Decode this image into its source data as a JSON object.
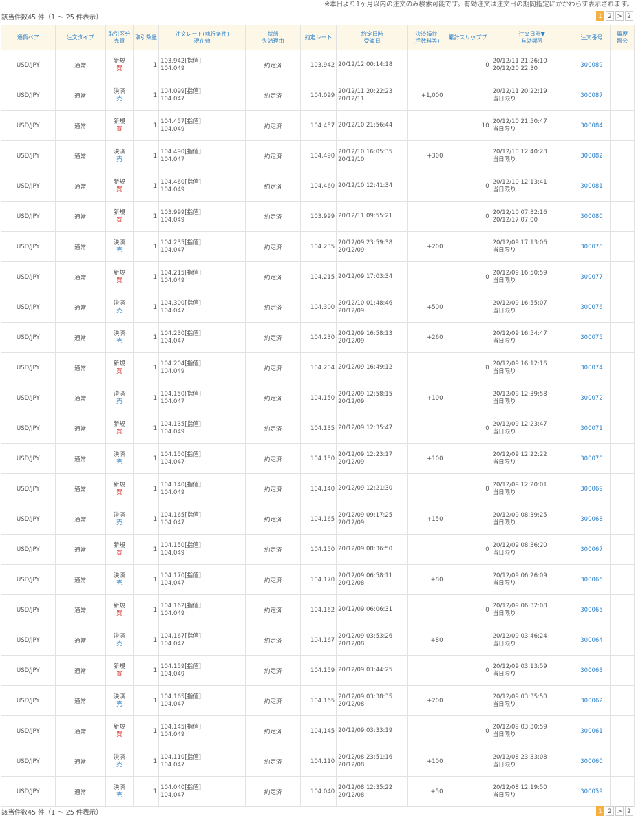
{
  "notice": "※本日より1ヶ月以内の注文のみ検索可能です。有効注文は注文日の期間指定にかかわらず表示されます。",
  "count_label": "該当件数45 件（1 ～ 25 件表示）",
  "count_label_bottom": "該当件数45 件（1 ～ 25 件表示）",
  "pager": [
    "1",
    "2",
    ">",
    "2"
  ],
  "colors": {
    "accent": "#f6b042",
    "header_bg": "#fdf7e8",
    "link": "#2f82c8",
    "sell": "#d9362f"
  },
  "headers": {
    "pair": "通貨ペア",
    "type": "注文タイプ",
    "trade_a": "取引区分",
    "trade_b": "売買",
    "qty": "取引数量",
    "rate_a": "注文レート(執行条件)",
    "rate_b": "現在値",
    "status_a": "状態",
    "status_b": "失効理由",
    "exec": "約定レート",
    "date_a": "約定日時",
    "date_b": "受渡日",
    "pl_a": "決済損益",
    "pl_b": "(手数料等)",
    "slip": "累計スリッププ",
    "order_a": "注文日時▼",
    "order_b": "有効期限",
    "no": "注文番号",
    "hist_a": "履歴",
    "hist_b": "照会"
  },
  "rows": [
    {
      "pair": "USD/JPY",
      "type": "通常",
      "kind": "新規",
      "side": "買",
      "rate": "103.942[指値]",
      "current": "104.049",
      "status": "約定済",
      "exec": "103.942",
      "date1": "20/12/12 00:14:18",
      "date2": "",
      "pl": "",
      "slip": "0",
      "od1": "20/12/11 21:26:10",
      "od2": "20/12/20 22:30",
      "no": "300089"
    },
    {
      "pair": "USD/JPY",
      "type": "通常",
      "kind": "決済",
      "side": "売",
      "rate": "104.099[指値]",
      "current": "104.047",
      "status": "約定済",
      "exec": "104.099",
      "date1": "20/12/11 20:22:23",
      "date2": "20/12/11",
      "pl": "+1,000",
      "slip": "",
      "od1": "20/12/11 20:22:19",
      "od2": "当日限り",
      "no": "300087"
    },
    {
      "pair": "USD/JPY",
      "type": "通常",
      "kind": "新規",
      "side": "買",
      "rate": "104.457[指値]",
      "current": "104.049",
      "status": "約定済",
      "exec": "104.457",
      "date1": "20/12/10 21:56:44",
      "date2": "",
      "pl": "",
      "slip": "10",
      "od1": "20/12/10 21:50:47",
      "od2": "当日限り",
      "no": "300084"
    },
    {
      "pair": "USD/JPY",
      "type": "通常",
      "kind": "決済",
      "side": "売",
      "rate": "104.490[指値]",
      "current": "104.047",
      "status": "約定済",
      "exec": "104.490",
      "date1": "20/12/10 16:05:35",
      "date2": "20/12/10",
      "pl": "+300",
      "slip": "",
      "od1": "20/12/10 12:40:28",
      "od2": "当日限り",
      "no": "300082"
    },
    {
      "pair": "USD/JPY",
      "type": "通常",
      "kind": "新規",
      "side": "買",
      "rate": "104.460[指値]",
      "current": "104.049",
      "status": "約定済",
      "exec": "104.460",
      "date1": "20/12/10 12:41:34",
      "date2": "",
      "pl": "",
      "slip": "0",
      "od1": "20/12/10 12:13:41",
      "od2": "当日限り",
      "no": "300081"
    },
    {
      "pair": "USD/JPY",
      "type": "通常",
      "kind": "新規",
      "side": "買",
      "rate": "103.999[指値]",
      "current": "104.049",
      "status": "約定済",
      "exec": "103.999",
      "date1": "20/12/11 09:55:21",
      "date2": "",
      "pl": "",
      "slip": "0",
      "od1": "20/12/10 07:32:16",
      "od2": "20/12/17 07:00",
      "no": "300080"
    },
    {
      "pair": "USD/JPY",
      "type": "通常",
      "kind": "決済",
      "side": "売",
      "rate": "104.235[指値]",
      "current": "104.047",
      "status": "約定済",
      "exec": "104.235",
      "date1": "20/12/09 23:59:38",
      "date2": "20/12/09",
      "pl": "+200",
      "slip": "",
      "od1": "20/12/09 17:13:06",
      "od2": "当日限り",
      "no": "300078"
    },
    {
      "pair": "USD/JPY",
      "type": "通常",
      "kind": "新規",
      "side": "買",
      "rate": "104.215[指値]",
      "current": "104.049",
      "status": "約定済",
      "exec": "104.215",
      "date1": "20/12/09 17:03:34",
      "date2": "",
      "pl": "",
      "slip": "0",
      "od1": "20/12/09 16:50:59",
      "od2": "当日限り",
      "no": "300077"
    },
    {
      "pair": "USD/JPY",
      "type": "通常",
      "kind": "決済",
      "side": "売",
      "rate": "104.300[指値]",
      "current": "104.047",
      "status": "約定済",
      "exec": "104.300",
      "date1": "20/12/10 01:48:46",
      "date2": "20/12/09",
      "pl": "+500",
      "slip": "",
      "od1": "20/12/09 16:55:07",
      "od2": "当日限り",
      "no": "300076"
    },
    {
      "pair": "USD/JPY",
      "type": "通常",
      "kind": "決済",
      "side": "売",
      "rate": "104.230[指値]",
      "current": "104.047",
      "status": "約定済",
      "exec": "104.230",
      "date1": "20/12/09 16:58:13",
      "date2": "20/12/09",
      "pl": "+260",
      "slip": "",
      "od1": "20/12/09 16:54:47",
      "od2": "当日限り",
      "no": "300075"
    },
    {
      "pair": "USD/JPY",
      "type": "通常",
      "kind": "新規",
      "side": "買",
      "rate": "104.204[指値]",
      "current": "104.049",
      "status": "約定済",
      "exec": "104.204",
      "date1": "20/12/09 16:49:12",
      "date2": "",
      "pl": "",
      "slip": "0",
      "od1": "20/12/09 16:12:16",
      "od2": "当日限り",
      "no": "300074"
    },
    {
      "pair": "USD/JPY",
      "type": "通常",
      "kind": "決済",
      "side": "売",
      "rate": "104.150[指値]",
      "current": "104.047",
      "status": "約定済",
      "exec": "104.150",
      "date1": "20/12/09 12:58:15",
      "date2": "20/12/09",
      "pl": "+100",
      "slip": "",
      "od1": "20/12/09 12:39:58",
      "od2": "当日限り",
      "no": "300072"
    },
    {
      "pair": "USD/JPY",
      "type": "通常",
      "kind": "新規",
      "side": "買",
      "rate": "104.135[指値]",
      "current": "104.049",
      "status": "約定済",
      "exec": "104.135",
      "date1": "20/12/09 12:35:47",
      "date2": "",
      "pl": "",
      "slip": "0",
      "od1": "20/12/09 12:23:47",
      "od2": "当日限り",
      "no": "300071"
    },
    {
      "pair": "USD/JPY",
      "type": "通常",
      "kind": "決済",
      "side": "売",
      "rate": "104.150[指値]",
      "current": "104.047",
      "status": "約定済",
      "exec": "104.150",
      "date1": "20/12/09 12:23:17",
      "date2": "20/12/09",
      "pl": "+100",
      "slip": "",
      "od1": "20/12/09 12:22:22",
      "od2": "当日限り",
      "no": "300070"
    },
    {
      "pair": "USD/JPY",
      "type": "通常",
      "kind": "新規",
      "side": "買",
      "rate": "104.140[指値]",
      "current": "104.049",
      "status": "約定済",
      "exec": "104.140",
      "date1": "20/12/09 12:21:30",
      "date2": "",
      "pl": "",
      "slip": "0",
      "od1": "20/12/09 12:20:01",
      "od2": "当日限り",
      "no": "300069"
    },
    {
      "pair": "USD/JPY",
      "type": "通常",
      "kind": "決済",
      "side": "売",
      "rate": "104.165[指値]",
      "current": "104.047",
      "status": "約定済",
      "exec": "104.165",
      "date1": "20/12/09 09:17:25",
      "date2": "20/12/09",
      "pl": "+150",
      "slip": "",
      "od1": "20/12/09 08:39:25",
      "od2": "当日限り",
      "no": "300068"
    },
    {
      "pair": "USD/JPY",
      "type": "通常",
      "kind": "新規",
      "side": "買",
      "rate": "104.150[指値]",
      "current": "104.049",
      "status": "約定済",
      "exec": "104.150",
      "date1": "20/12/09 08:36:50",
      "date2": "",
      "pl": "",
      "slip": "0",
      "od1": "20/12/09 08:36:20",
      "od2": "当日限り",
      "no": "300067"
    },
    {
      "pair": "USD/JPY",
      "type": "通常",
      "kind": "決済",
      "side": "売",
      "rate": "104.170[指値]",
      "current": "104.047",
      "status": "約定済",
      "exec": "104.170",
      "date1": "20/12/09 06:58:11",
      "date2": "20/12/08",
      "pl": "+80",
      "slip": "",
      "od1": "20/12/09 06:26:09",
      "od2": "当日限り",
      "no": "300066"
    },
    {
      "pair": "USD/JPY",
      "type": "通常",
      "kind": "新規",
      "side": "買",
      "rate": "104.162[指値]",
      "current": "104.049",
      "status": "約定済",
      "exec": "104.162",
      "date1": "20/12/09 06:06:31",
      "date2": "",
      "pl": "",
      "slip": "0",
      "od1": "20/12/09 06:32:08",
      "od2": "当日限り",
      "no": "300065"
    },
    {
      "pair": "USD/JPY",
      "type": "通常",
      "kind": "決済",
      "side": "売",
      "rate": "104.167[指値]",
      "current": "104.047",
      "status": "約定済",
      "exec": "104.167",
      "date1": "20/12/09 03:53:26",
      "date2": "20/12/08",
      "pl": "+80",
      "slip": "",
      "od1": "20/12/09 03:46:24",
      "od2": "当日限り",
      "no": "300064"
    },
    {
      "pair": "USD/JPY",
      "type": "通常",
      "kind": "新規",
      "side": "買",
      "rate": "104.159[指値]",
      "current": "104.049",
      "status": "約定済",
      "exec": "104.159",
      "date1": "20/12/09 03:44:25",
      "date2": "",
      "pl": "",
      "slip": "0",
      "od1": "20/12/09 03:13:59",
      "od2": "当日限り",
      "no": "300063"
    },
    {
      "pair": "USD/JPY",
      "type": "通常",
      "kind": "決済",
      "side": "売",
      "rate": "104.165[指値]",
      "current": "104.047",
      "status": "約定済",
      "exec": "104.165",
      "date1": "20/12/09 03:38:35",
      "date2": "20/12/08",
      "pl": "+200",
      "slip": "",
      "od1": "20/12/09 03:35:50",
      "od2": "当日限り",
      "no": "300062"
    },
    {
      "pair": "USD/JPY",
      "type": "通常",
      "kind": "新規",
      "side": "買",
      "rate": "104.145[指値]",
      "current": "104.049",
      "status": "約定済",
      "exec": "104.145",
      "date1": "20/12/09 03:33:19",
      "date2": "",
      "pl": "",
      "slip": "0",
      "od1": "20/12/09 03:30:59",
      "od2": "当日限り",
      "no": "300061"
    },
    {
      "pair": "USD/JPY",
      "type": "通常",
      "kind": "決済",
      "side": "売",
      "rate": "104.110[指値]",
      "current": "104.047",
      "status": "約定済",
      "exec": "104.110",
      "date1": "20/12/08 23:51:16",
      "date2": "20/12/08",
      "pl": "+100",
      "slip": "",
      "od1": "20/12/08 23:33:08",
      "od2": "当日限り",
      "no": "300060"
    },
    {
      "pair": "USD/JPY",
      "type": "通常",
      "kind": "決済",
      "side": "売",
      "rate": "104.040[指値]",
      "current": "104.047",
      "status": "約定済",
      "exec": "104.040",
      "date1": "20/12/08 12:35:22",
      "date2": "20/12/08",
      "pl": "+50",
      "slip": "",
      "od1": "20/12/08 12:19:50",
      "od2": "当日限り",
      "no": "300059"
    }
  ]
}
